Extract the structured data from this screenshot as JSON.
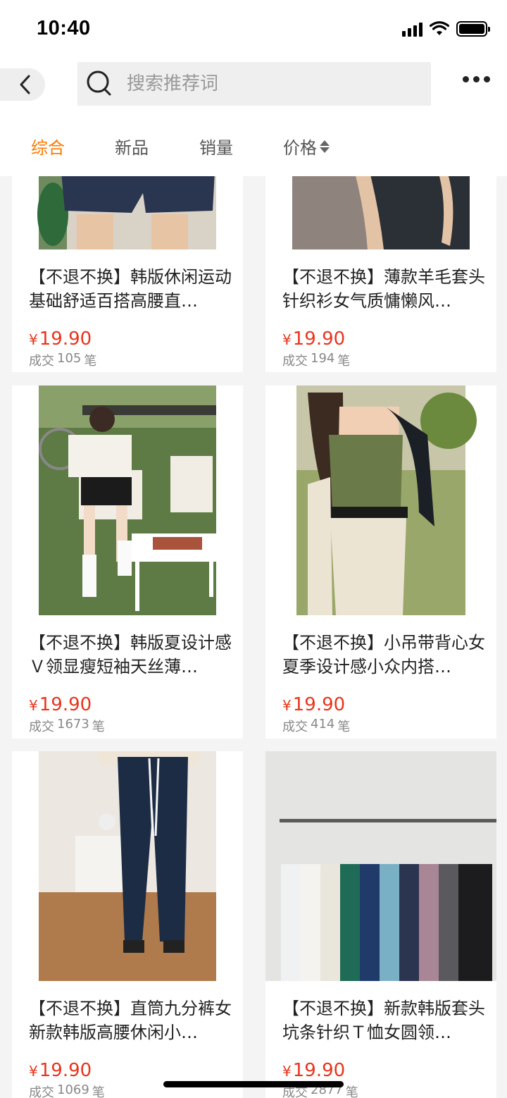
{
  "status_bar": {
    "time": "10:40"
  },
  "search": {
    "placeholder": "搜索推荐词"
  },
  "sort_tabs": [
    {
      "label": "综合",
      "active": true
    },
    {
      "label": "新品",
      "active": false
    },
    {
      "label": "销量",
      "active": false
    },
    {
      "label": "价格",
      "active": false
    }
  ],
  "colors": {
    "accent": "#ff7a00",
    "price": "#e8351e"
  },
  "products": [
    {
      "title": "【不退不换】韩版休闲运动基础舒适百搭高腰直…",
      "currency": "¥",
      "price": "19.90",
      "sales_prefix": "成交",
      "sales_count": "105",
      "sales_suffix": "笔"
    },
    {
      "title": "【不退不换】薄款羊毛套头针织衫女气质慵懒风…",
      "currency": "¥",
      "price": "19.90",
      "sales_prefix": "成交",
      "sales_count": "194",
      "sales_suffix": "笔"
    },
    {
      "title": "【不退不换】韩版夏设计感Ｖ领显瘦短袖天丝薄…",
      "currency": "¥",
      "price": "19.90",
      "sales_prefix": "成交",
      "sales_count": "1673",
      "sales_suffix": "笔"
    },
    {
      "title": "【不退不换】小吊带背心女夏季设计感小众内搭…",
      "currency": "¥",
      "price": "19.90",
      "sales_prefix": "成交",
      "sales_count": "414",
      "sales_suffix": "笔"
    },
    {
      "title": "【不退不换】直筒九分裤女新款韩版高腰休闲小…",
      "currency": "¥",
      "price": "19.90",
      "sales_prefix": "成交",
      "sales_count": "1069",
      "sales_suffix": "笔"
    },
    {
      "title": "【不退不换】新款韩版套头坑条针织Ｔ恤女圆领…",
      "currency": "¥",
      "price": "19.90",
      "sales_prefix": "成交",
      "sales_count": "2877",
      "sales_suffix": "笔"
    }
  ]
}
